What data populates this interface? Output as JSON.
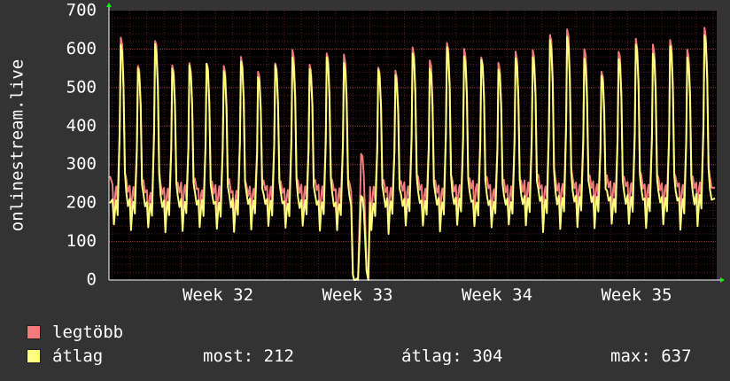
{
  "chart_data": {
    "type": "line",
    "ylabel": "onlinestream.live",
    "ylim": [
      0,
      700
    ],
    "yticks": [
      "0",
      "100",
      "200",
      "300",
      "400",
      "500",
      "600",
      "700"
    ],
    "xticks": [
      "Week 32",
      "Week 33",
      "Week 34",
      "Week 35"
    ],
    "grid": true,
    "background": "#000000",
    "grid_color": "#7a2020",
    "series": [
      {
        "name": "legtöbb",
        "color": "#f07c7c",
        "daily_peaks": [
          630,
          560,
          625,
          560,
          560,
          565,
          555,
          580,
          545,
          565,
          595,
          560,
          590,
          585,
          330,
          555,
          545,
          605,
          570,
          615,
          600,
          580,
          565,
          590,
          595,
          640,
          655,
          600,
          545,
          595,
          625,
          610,
          620,
          595,
          655
        ],
        "daily_base": [
          235,
          235,
          225,
          230,
          240,
          230,
          235,
          225,
          235,
          235,
          230,
          235,
          235,
          230,
          0,
          235,
          235,
          240,
          235,
          235,
          240,
          245,
          235,
          235,
          245,
          240,
          245,
          245,
          245,
          245,
          245,
          240,
          245,
          240,
          245
        ],
        "end_value": 240
      },
      {
        "name": "átlag",
        "color": "#ffff80",
        "daily_peaks": [
          615,
          550,
          610,
          550,
          555,
          560,
          540,
          570,
          530,
          555,
          575,
          550,
          575,
          565,
          220,
          545,
          530,
          590,
          550,
          605,
          580,
          570,
          550,
          575,
          580,
          620,
          630,
          575,
          530,
          575,
          610,
          590,
          605,
          580,
          635
        ],
        "daily_base": [
          200,
          200,
          195,
          195,
          200,
          200,
          195,
          200,
          200,
          200,
          195,
          200,
          200,
          195,
          0,
          195,
          200,
          205,
          200,
          200,
          205,
          200,
          200,
          200,
          210,
          205,
          210,
          210,
          210,
          205,
          210,
          205,
          210,
          205,
          212
        ],
        "end_value": 212
      }
    ]
  },
  "legend": {
    "items": [
      {
        "label": "legtöbb",
        "color": "#f07c7c"
      },
      {
        "label": "átlag",
        "color": "#ffff80"
      }
    ],
    "stats": {
      "current": "most: 212",
      "average": "átlag: 304",
      "max": "max: 637"
    }
  }
}
